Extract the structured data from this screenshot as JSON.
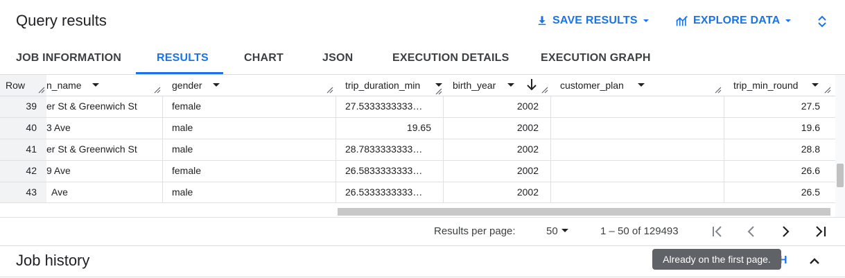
{
  "header": {
    "title": "Query results",
    "save_results_label": "SAVE RESULTS",
    "explore_data_label": "EXPLORE DATA",
    "accent_color": "#1a73e8"
  },
  "tabs": [
    {
      "label": "JOB INFORMATION",
      "active": false
    },
    {
      "label": "RESULTS",
      "active": true
    },
    {
      "label": "CHART",
      "active": false
    },
    {
      "label": "JSON",
      "active": false
    },
    {
      "label": "EXECUTION DETAILS",
      "active": false
    },
    {
      "label": "EXECUTION GRAPH",
      "active": false
    }
  ],
  "table": {
    "row_header": "Row",
    "columns": [
      {
        "label": "n_name"
      },
      {
        "label": "gender"
      },
      {
        "label": "trip_duration_min"
      },
      {
        "label": "birth_year",
        "sorted": "descending"
      },
      {
        "label": "customer_plan"
      },
      {
        "label": "trip_min_round"
      }
    ],
    "rows": [
      {
        "row": "39",
        "cells": [
          "er St & Greenwich St",
          "female",
          "27.5333333333…",
          "2002",
          "",
          "27.5"
        ]
      },
      {
        "row": "40",
        "cells": [
          "3 Ave",
          "male",
          "19.65",
          "2002",
          "",
          "19.6"
        ]
      },
      {
        "row": "41",
        "cells": [
          "er St & Greenwich St",
          "male",
          "28.7833333333…",
          "2002",
          "",
          "28.8"
        ]
      },
      {
        "row": "42",
        "cells": [
          "9 Ave",
          "female",
          "26.5833333333…",
          "2002",
          "",
          "26.6"
        ]
      },
      {
        "row": "43",
        "cells": [
          "Ave",
          "male",
          "26.5333333333…",
          "2002",
          "",
          "26.5"
        ]
      }
    ]
  },
  "pager": {
    "per_page_label": "Results per page:",
    "per_page_value": "50",
    "range_text": "1 – 50 of 129493"
  },
  "job_history": {
    "title": "Job history",
    "partial_action": "H"
  },
  "tooltip": {
    "text": "Already on the first page."
  }
}
